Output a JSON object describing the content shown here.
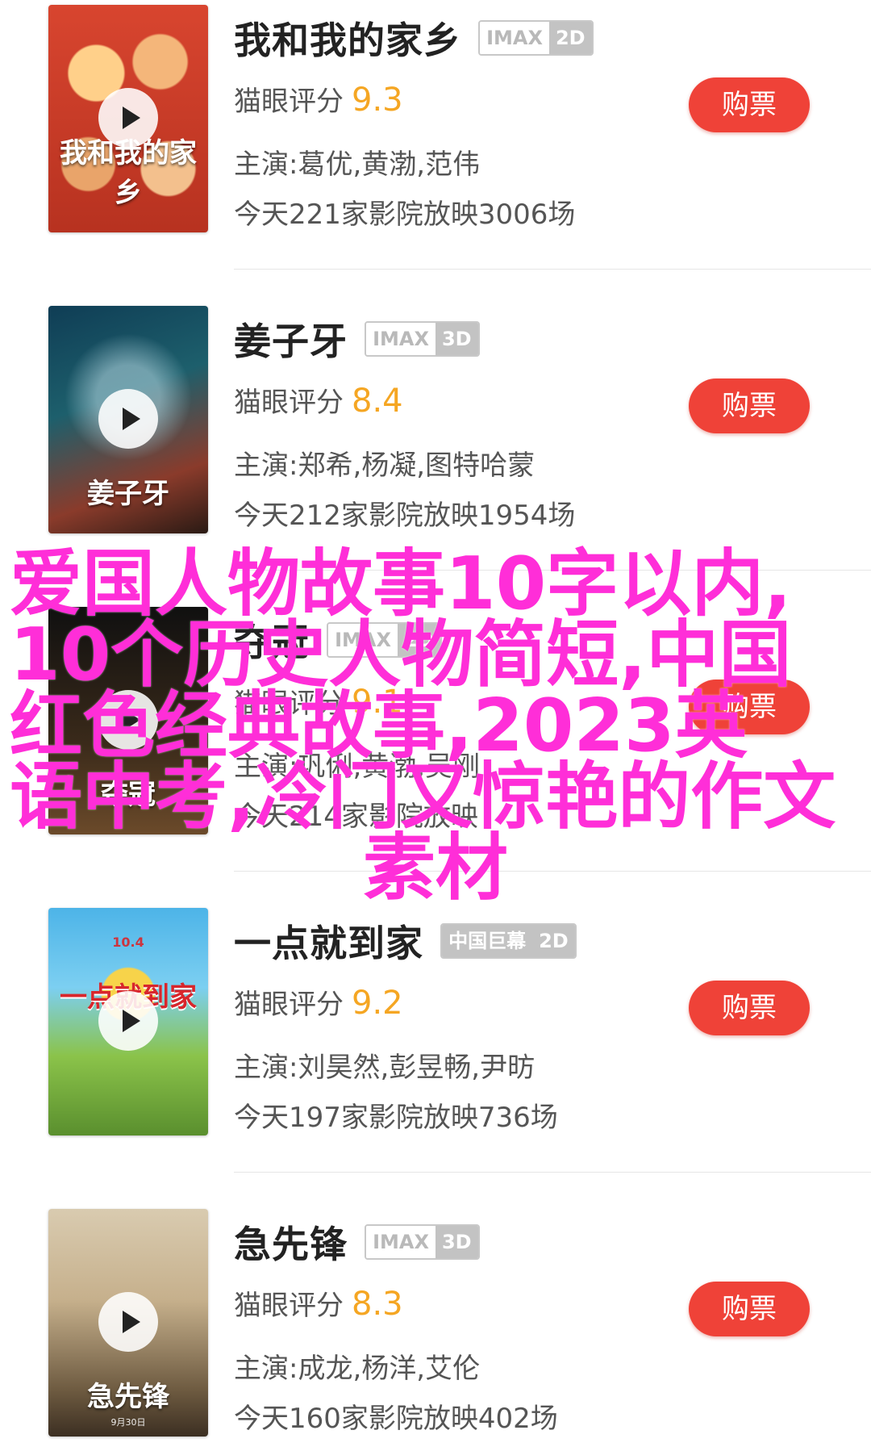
{
  "movies": [
    {
      "title": "我和我的家乡",
      "tag_left": "IMAX",
      "tag_right": "2D",
      "score_label": "猫眼评分",
      "score": "9.3",
      "actors": "主演:葛优,黄渤,范伟",
      "schedule": "今天221家影院放映3006场",
      "buy_label": "购票",
      "poster_text": "我和我的家乡"
    },
    {
      "title": "姜子牙",
      "tag_left": "IMAX",
      "tag_right": "3D",
      "score_label": "猫眼评分",
      "score": "8.4",
      "actors": "主演:郑希,杨凝,图特哈蒙",
      "schedule": "今天212家影院放映1954场",
      "buy_label": "购票",
      "poster_text": "姜子牙"
    },
    {
      "title": "夺冠",
      "tag_left": "IMAX",
      "tag_right": "2D",
      "score_label": "猫眼评分",
      "score": "9.1",
      "actors": "主演:巩俐,黄渤,吴刚",
      "schedule": "今天214家影院放映",
      "buy_label": "购票",
      "poster_text": "夺冠"
    },
    {
      "title": "一点就到家",
      "tag_left": "中国巨幕",
      "tag_right": "2D",
      "score_label": "猫眼评分",
      "score": "9.2",
      "actors": "主演:刘昊然,彭昱畅,尹昉",
      "schedule": "今天197家影院放映736场",
      "buy_label": "购票",
      "poster_text": "一点就到家",
      "poster_date": "10.4"
    },
    {
      "title": "急先锋",
      "tag_left": "IMAX",
      "tag_right": "3D",
      "score_label": "猫眼评分",
      "score": "8.3",
      "actors": "主演:成龙,杨洋,艾伦",
      "schedule": "今天160家影院放映402场",
      "buy_label": "购票",
      "poster_text": "急先锋",
      "poster_date": "9月30日"
    }
  ],
  "overlay": {
    "line1": "爱国人物故事10字以内,",
    "line2": "10个历史人物简短,中国",
    "line3": "红色经典故事,2023英",
    "line4": "语中考,冷门又惊艳的作文",
    "line5": "素材"
  },
  "colors": {
    "buy_button": "#ef4238",
    "score": "#f5a623",
    "overlay_text": "#ff2ed8"
  }
}
